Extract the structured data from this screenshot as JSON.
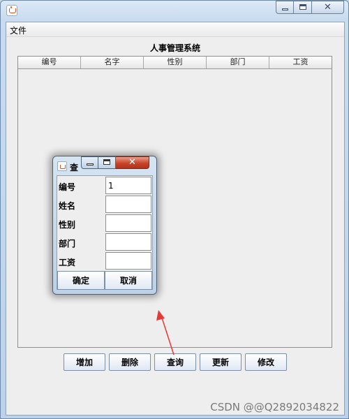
{
  "window": {
    "title": ""
  },
  "menu": {
    "items": [
      "文件"
    ]
  },
  "system_title": "人事管理系统",
  "table": {
    "columns": [
      "编号",
      "名字",
      "性别",
      "部门",
      "工资"
    ],
    "rows": []
  },
  "buttons": [
    "增加",
    "删除",
    "查询",
    "更新",
    "修改"
  ],
  "dialog": {
    "title": "查",
    "fields": [
      {
        "label": "编号",
        "value": "1"
      },
      {
        "label": "姓名",
        "value": ""
      },
      {
        "label": "性别",
        "value": ""
      },
      {
        "label": "部门",
        "value": ""
      },
      {
        "label": "工资",
        "value": ""
      }
    ],
    "confirm_label": "确定",
    "cancel_label": "取消"
  },
  "annotation": {
    "arrow_color": "#e53935"
  },
  "watermark": "CSDN @@Q2892034822"
}
